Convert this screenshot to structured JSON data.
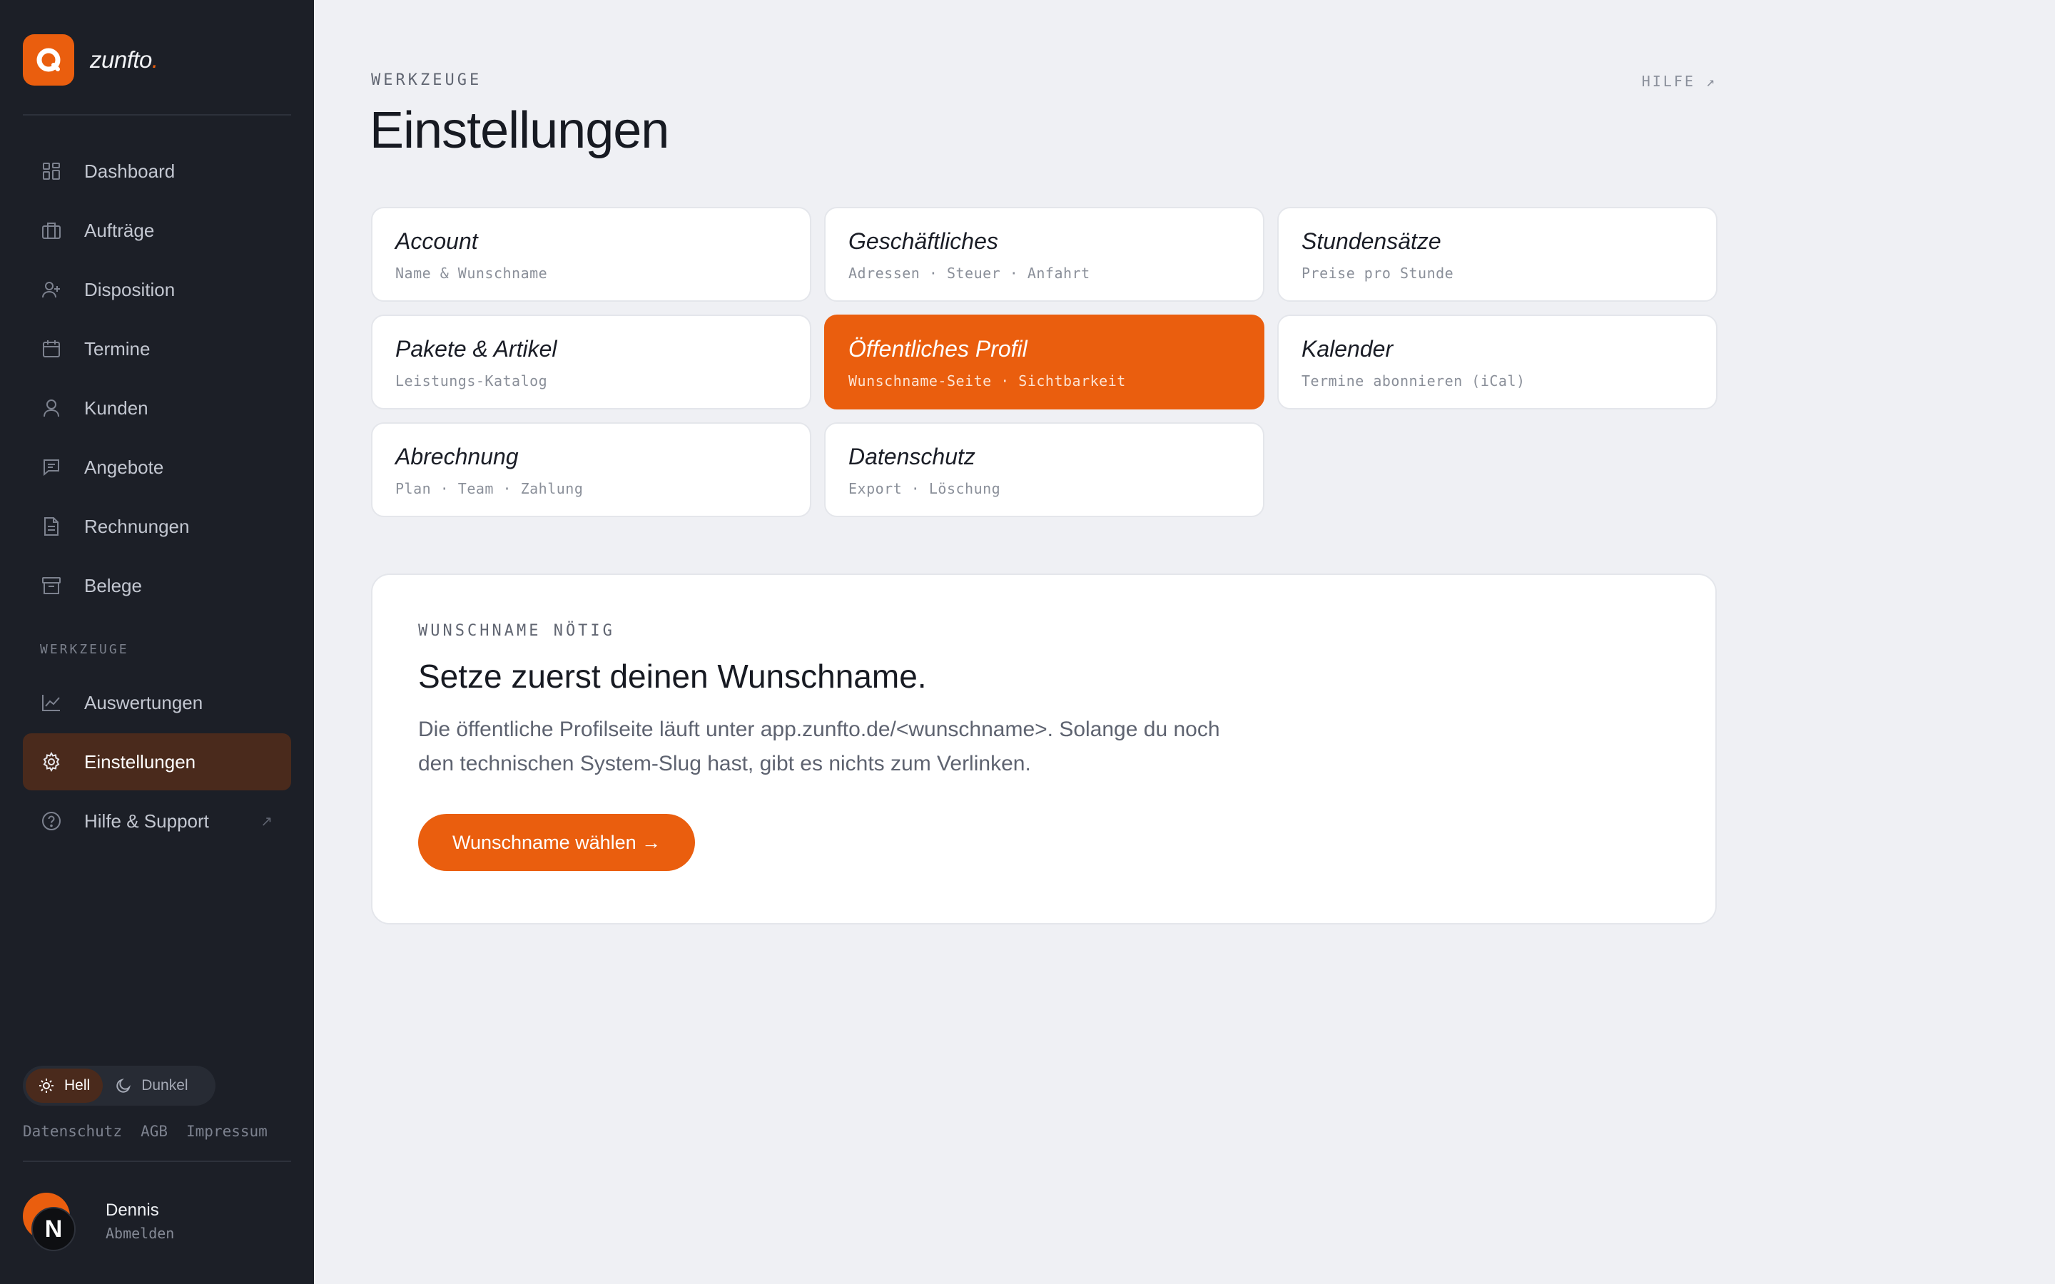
{
  "brand": {
    "name": "zunfto",
    "dot": "."
  },
  "sidebar": {
    "items": [
      {
        "label": "Dashboard",
        "icon": "grid-icon"
      },
      {
        "label": "Aufträge",
        "icon": "briefcase-icon"
      },
      {
        "label": "Disposition",
        "icon": "user-plus-icon"
      },
      {
        "label": "Termine",
        "icon": "calendar-icon"
      },
      {
        "label": "Kunden",
        "icon": "user-icon"
      },
      {
        "label": "Angebote",
        "icon": "message-icon"
      },
      {
        "label": "Rechnungen",
        "icon": "document-icon"
      },
      {
        "label": "Belege",
        "icon": "archive-icon"
      }
    ],
    "section_label": "WERKZEUGE",
    "tools": [
      {
        "label": "Auswertungen",
        "icon": "chart-icon"
      },
      {
        "label": "Einstellungen",
        "icon": "gear-icon",
        "active": true
      },
      {
        "label": "Hilfe & Support",
        "icon": "help-circle-icon",
        "external": "↗"
      }
    ],
    "theme": {
      "light": "Hell",
      "dark": "Dunkel",
      "selected": "Hell"
    },
    "legal": [
      "Datenschutz",
      "AGB",
      "Impressum"
    ],
    "user": {
      "initial": "N",
      "name": "Dennis",
      "action": "Abmelden"
    }
  },
  "header": {
    "eyebrow": "WERKZEUGE",
    "title": "Einstellungen",
    "help": "HILFE ↗"
  },
  "cards": [
    {
      "title": "Account",
      "subtitle": "Name & Wunschname"
    },
    {
      "title": "Geschäftliches",
      "subtitle": "Adressen · Steuer · Anfahrt"
    },
    {
      "title": "Stundensätze",
      "subtitle": "Preise pro Stunde"
    },
    {
      "title": "Pakete & Artikel",
      "subtitle": "Leistungs-Katalog"
    },
    {
      "title": "Öffentliches Profil",
      "subtitle": "Wunschname-Seite · Sichtbarkeit",
      "active": true
    },
    {
      "title": "Kalender",
      "subtitle": "Termine abonnieren (iCal)"
    },
    {
      "title": "Abrechnung",
      "subtitle": "Plan · Team · Zahlung"
    },
    {
      "title": "Datenschutz",
      "subtitle": "Export · Löschung"
    }
  ],
  "notice": {
    "kicker": "WUNSCHNAME NÖTIG",
    "heading": "Setze zuerst deinen Wunschname.",
    "body": "Die öffentliche Profilseite läuft unter app.zunfto.de/<wunschname>. Solange du noch den technischen System-Slug hast, gibt es nichts zum Verlinken.",
    "cta": "Wunschname wählen →"
  },
  "colors": {
    "accent": "#ea5e0e",
    "sidebar_bg": "#1c1f27",
    "page_bg": "#eff0f4",
    "active_nav": "#4a2a1c"
  }
}
